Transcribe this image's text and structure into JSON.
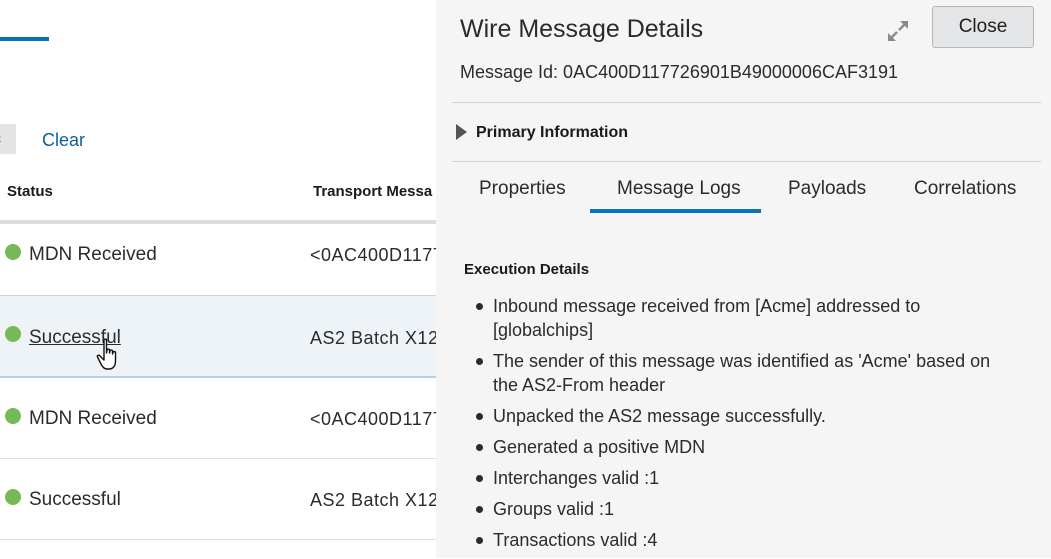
{
  "background": {
    "clear_label": "Clear",
    "columns": {
      "status": "Status",
      "transport": "Transport Messa"
    },
    "rows": [
      {
        "status": "MDN Received",
        "transport": "<0AC400D1177"
      },
      {
        "status": "Successful",
        "transport": "AS2 Batch X12"
      },
      {
        "status": "MDN Received",
        "transport": "<0AC400D1177"
      },
      {
        "status": "Successful",
        "transport": "AS2 Batch X12"
      }
    ],
    "status_color": "#77b957"
  },
  "drawer": {
    "title": "Wire Message Details",
    "close_label": "Close",
    "message_id": "Message Id: 0AC400D117726901B49000006CAF3191",
    "primary_info_label": "Primary Information",
    "tabs": [
      "Properties",
      "Message Logs",
      "Payloads",
      "Correlations"
    ],
    "active_tab": "Message Logs",
    "execution_title": "Execution Details",
    "logs": [
      "Inbound message received from [Acme] addressed to [globalchips]",
      "The sender of this message was identified as 'Acme' based on the AS2-From header",
      "Unpacked the AS2 message successfully.",
      "Generated a positive MDN",
      "Interchanges valid :1",
      "Groups valid :1",
      "Transactions valid :4"
    ],
    "accent_color": "#0b72b9"
  }
}
